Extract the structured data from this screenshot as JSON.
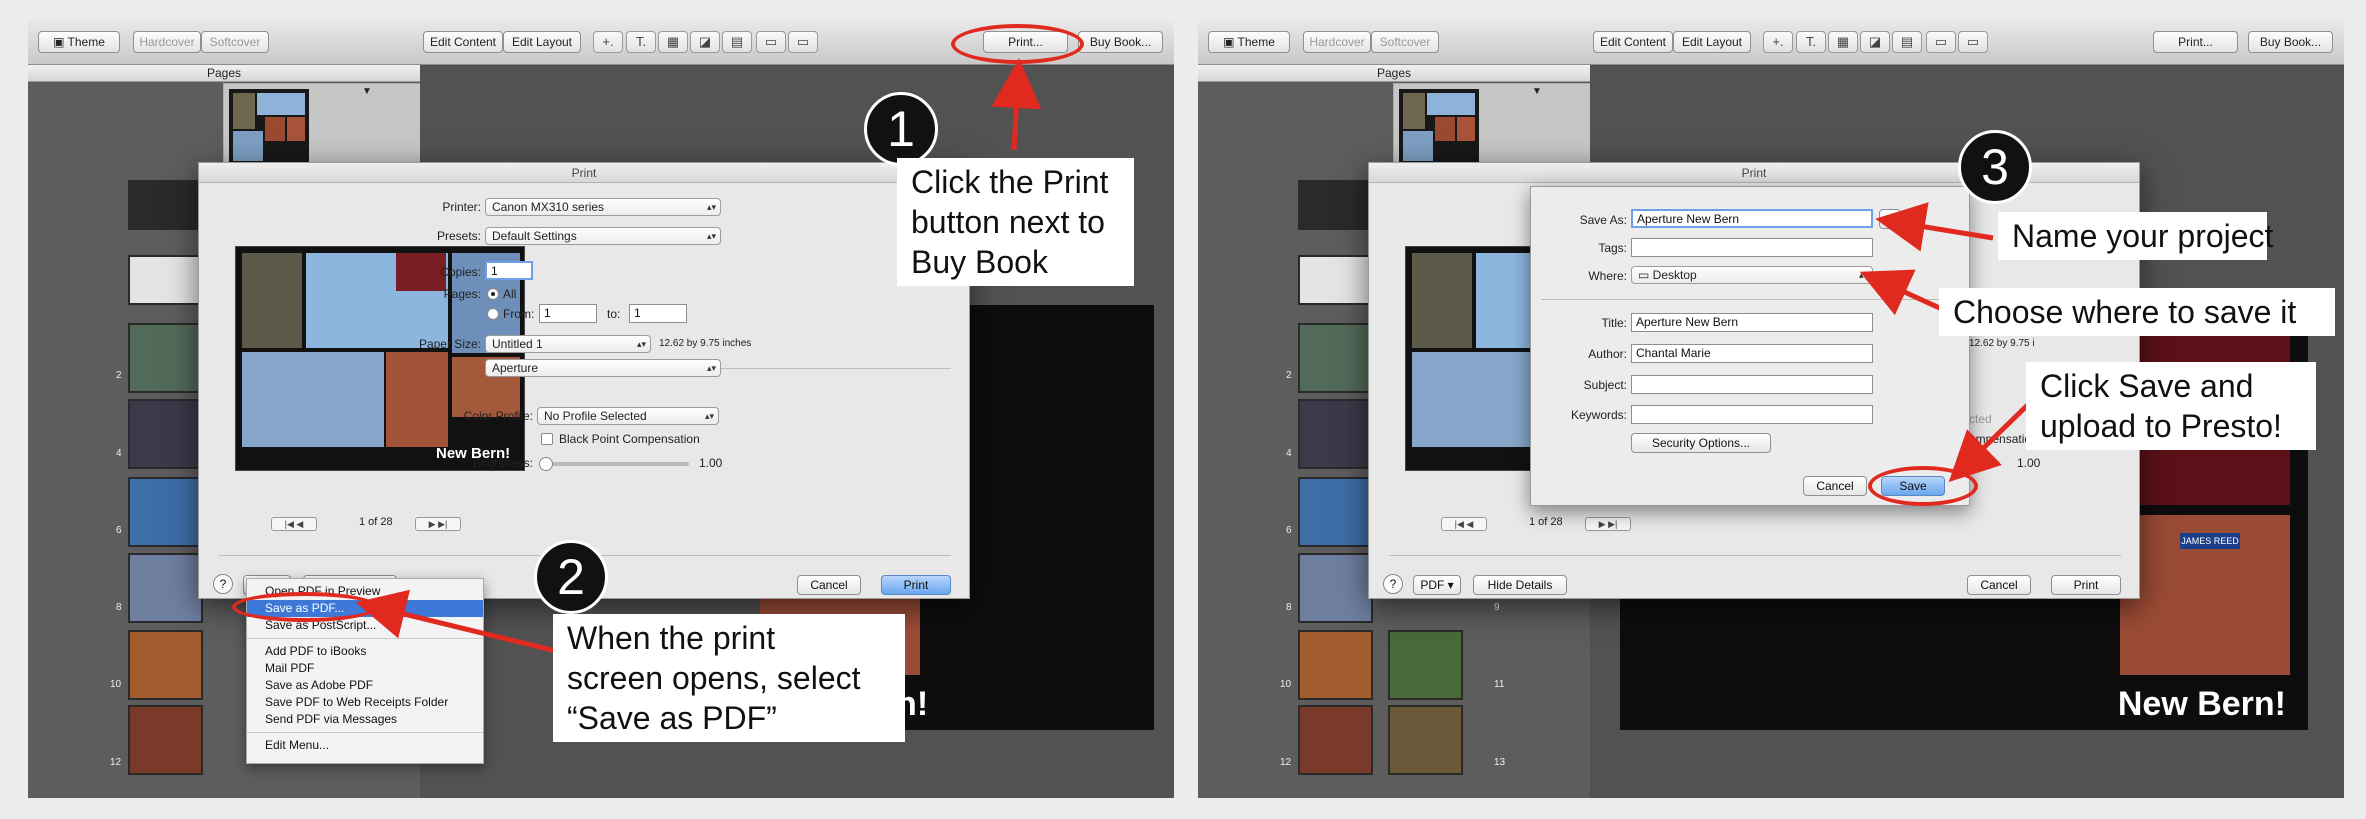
{
  "toolbar": {
    "theme": "Theme",
    "hardcover": "Hardcover",
    "softcover": "Softcover",
    "edit_content": "Edit Content",
    "edit_layout": "Edit Layout",
    "add": "+.",
    "print": "Print...",
    "buy_book": "Buy Book..."
  },
  "sidebar": {
    "header": "Pages",
    "page_numbers_left": [
      "2",
      "4",
      "6",
      "8",
      "10",
      "12"
    ],
    "page_numbers_right": [
      "9",
      "11",
      "13"
    ]
  },
  "print_dialog": {
    "title": "Print",
    "printer_label": "Printer:",
    "printer_value": "Canon MX310 series",
    "presets_label": "Presets:",
    "presets_value": "Default Settings",
    "copies_label": "Copies:",
    "copies_value": "1",
    "pages_label": "Pages:",
    "pages_all": "All",
    "pages_from": "From:",
    "from_value": "1",
    "to_label": "to:",
    "to_value": "1",
    "paper_size_label": "Paper Size:",
    "paper_size_value": "Untitled 1",
    "paper_size_dims": "12.62 by 9.75 inches",
    "app_section": "Aperture",
    "color_profile_label": "Color Profile:",
    "color_profile_value": "No Profile Selected",
    "bpc_label": "Black Point Compensation",
    "brightness_label": "Brightness:",
    "brightness_value": "1.00",
    "page_counter": "1 of 28",
    "help": "?",
    "pdf_button": "PDF",
    "hide_details": "Hide Details",
    "cancel": "Cancel",
    "print": "Print",
    "preview_caption": "New Bern!"
  },
  "pdf_menu": {
    "items": [
      "Open PDF in Preview",
      "Save as PDF...",
      "Save as PostScript..."
    ],
    "items2": [
      "Add PDF to iBooks",
      "Mail PDF",
      "Save as Adobe PDF",
      "Save PDF to Web Receipts Folder",
      "Send PDF via Messages"
    ],
    "items3": [
      "Edit Menu..."
    ]
  },
  "save_sheet": {
    "save_as_label": "Save As:",
    "save_as_value": "Aperture New Bern",
    "tags_label": "Tags:",
    "where_label": "Where:",
    "where_value": "Desktop",
    "title_label": "Title:",
    "title_value": "Aperture New Bern",
    "author_label": "Author:",
    "author_value": "Chantal Marie",
    "subject_label": "Subject:",
    "keywords_label": "Keywords:",
    "security": "Security Options...",
    "cancel": "Cancel",
    "save": "Save",
    "partial_dims": "12.62 by 9.75 i",
    "partial_profile": "No Profile Selected",
    "partial_comp": "ompensation"
  },
  "canvas": {
    "big_caption": "New Bern!",
    "sign_text": "JAMES REED"
  },
  "callouts": {
    "step1_number": "1",
    "step1_line1": "Click the Print",
    "step1_line2": "button next to",
    "step1_line3": "Buy Book",
    "step2_number": "2",
    "step2_line1": "When the print",
    "step2_line2": "screen opens, select",
    "step2_line3": "“Save as PDF”",
    "step3_number": "3",
    "step3_a": "Name your project",
    "step3_b": "Choose where to save it",
    "step3_c1": "Click Save and",
    "step3_c2": "upload to Presto!"
  },
  "colors": {
    "accent_red": "#e02a1f",
    "selection_blue": "#3d78d8"
  }
}
